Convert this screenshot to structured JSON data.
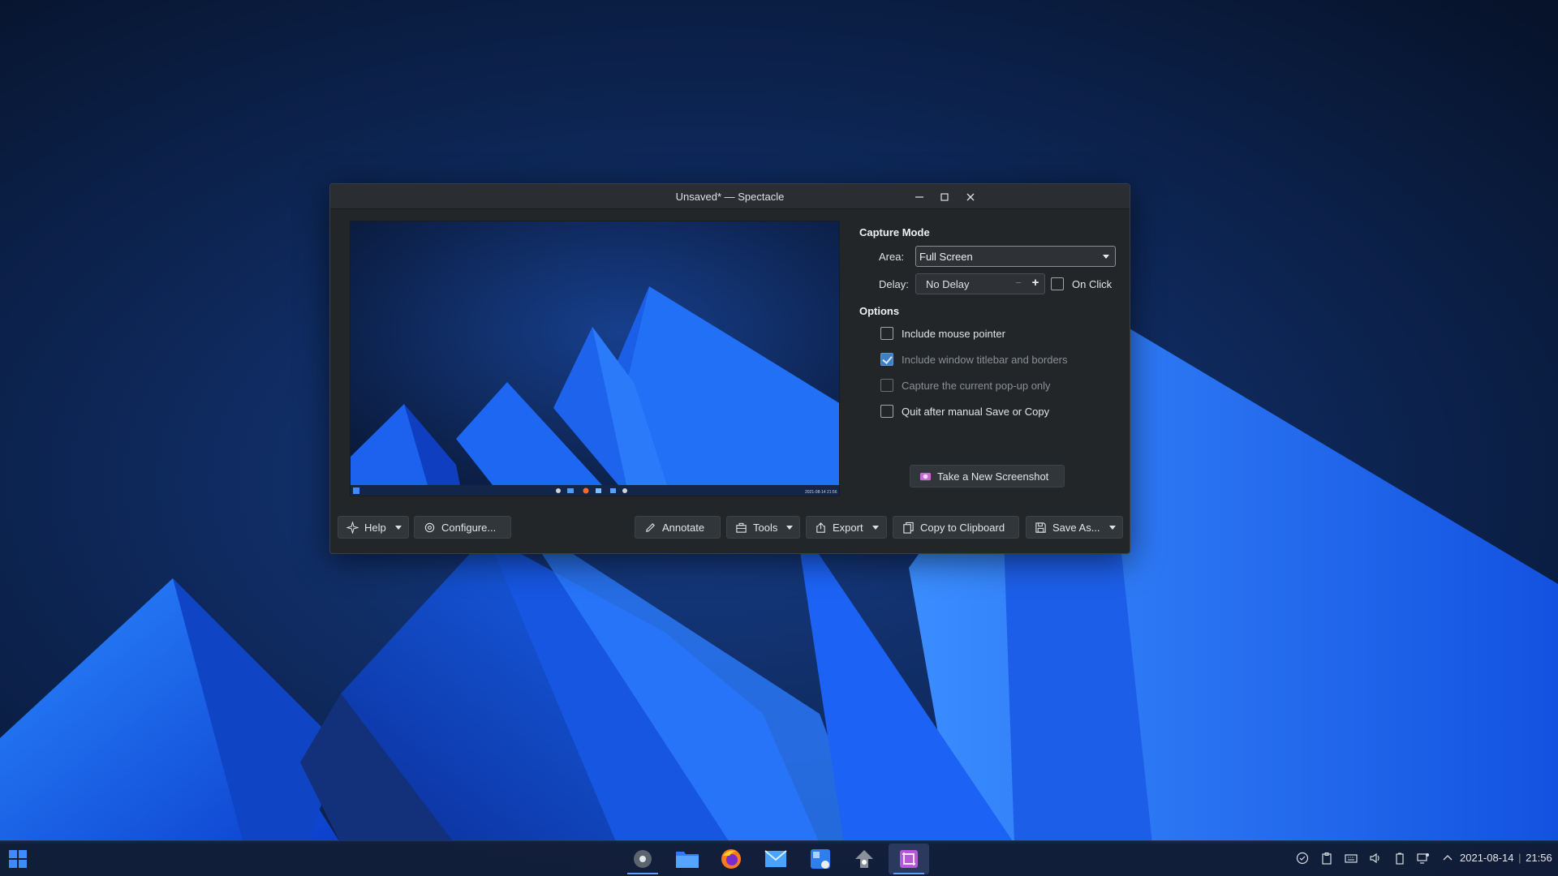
{
  "window": {
    "title": "Unsaved* — Spectacle"
  },
  "capture_mode": {
    "heading": "Capture Mode",
    "area_label": "Area:",
    "area_value": "Full Screen",
    "delay_label": "Delay:",
    "delay_value": "No Delay",
    "delay_minus": "−",
    "delay_plus": "+",
    "on_click_label": "On Click",
    "on_click_checked": false
  },
  "options": {
    "heading": "Options",
    "items": [
      {
        "label": "Include mouse pointer",
        "checked": false,
        "enabled": true
      },
      {
        "label": "Include window titlebar and borders",
        "checked": true,
        "enabled": false
      },
      {
        "label": "Capture the current pop-up only",
        "checked": false,
        "enabled": false
      },
      {
        "label": "Quit after manual Save or Copy",
        "checked": false,
        "enabled": true
      }
    ]
  },
  "take_screenshot_label": "Take a New Screenshot",
  "toolbar": {
    "help": "Help",
    "configure": "Configure...",
    "annotate": "Annotate",
    "tools": "Tools",
    "export": "Export",
    "copy": "Copy to Clipboard",
    "save_as": "Save As..."
  },
  "preview_taskbar_clock": "2021-08-14 21:56",
  "taskbar": {
    "apps": [
      {
        "name": "system-settings",
        "active": false
      },
      {
        "name": "dolphin-file-manager",
        "active": false
      },
      {
        "name": "firefox",
        "active": false
      },
      {
        "name": "mail",
        "active": false
      },
      {
        "name": "discover",
        "active": false
      },
      {
        "name": "kde-connect",
        "active": false
      },
      {
        "name": "spectacle",
        "active": true
      }
    ],
    "date": "2021-08-14",
    "time": "21:56"
  },
  "colors": {
    "accent": "#3d80c9",
    "window_bg": "#232629",
    "desktop_dark": "#0b1c3d",
    "desktop_blue": "#1f6bff"
  }
}
